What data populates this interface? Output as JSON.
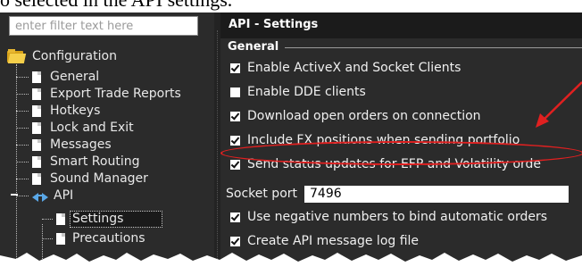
{
  "caption": {
    "text": "o selected in the API settings."
  },
  "filter": {
    "placeholder": "enter filter text here"
  },
  "tree": {
    "root_label": "Configuration",
    "items": [
      "General",
      "Export Trade Reports",
      "Hotkeys",
      "Lock and Exit",
      "Messages",
      "Smart Routing",
      "Sound Manager",
      "API"
    ],
    "api_children": [
      "Settings",
      "Precautions"
    ],
    "icons": {
      "root": "folder-icon",
      "item": "document-icon",
      "api": "api-arrows-icon"
    }
  },
  "panel": {
    "title": "API - Settings",
    "section": "General",
    "options": [
      {
        "label": "Enable ActiveX and Socket Clients",
        "checked": true
      },
      {
        "label": "Enable DDE clients",
        "checked": false
      },
      {
        "label": "Download open orders on connection",
        "checked": true
      },
      {
        "label": "Include FX positions when sending portfolio",
        "checked": true
      },
      {
        "label": "Send status updates for EFP and Volatility orde",
        "checked": true
      }
    ],
    "socket_port": {
      "label": "Socket port",
      "value": "7496"
    },
    "options_after": [
      {
        "label": "Use negative numbers to bind automatic orders",
        "checked": true
      },
      {
        "label": "Create API message log file",
        "checked": true
      }
    ]
  },
  "annotation": {
    "highlight_color": "#e02020",
    "highlighted_option": "Include FX positions when sending portfolio"
  },
  "colors": {
    "panel_bg": "#2b2b2b",
    "header_bg": "#1b1b1b",
    "text": "#f0f0f0"
  }
}
